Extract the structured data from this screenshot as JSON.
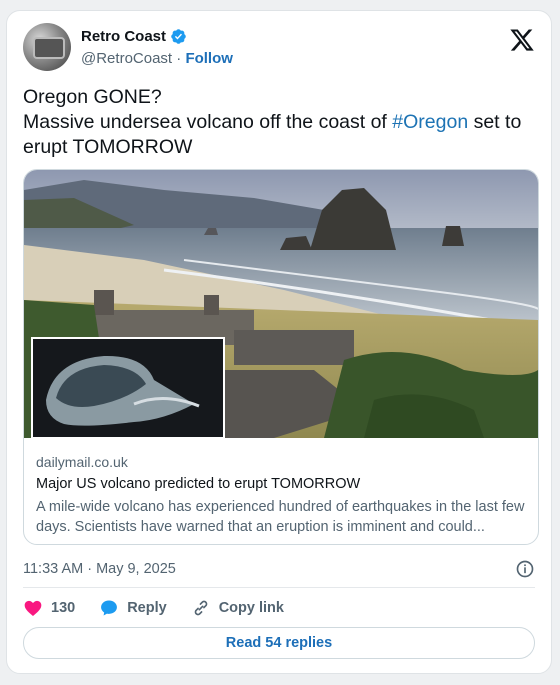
{
  "author": {
    "display_name": "Retro Coast",
    "handle": "@RetroCoast",
    "separator": "·",
    "follow_label": "Follow"
  },
  "tweet": {
    "line1": "Oregon GONE?",
    "line2_prefix": "Massive undersea volcano off the coast of ",
    "hashtag": "#Oregon",
    "line2_suffix": " set to erupt TOMORROW"
  },
  "link_card": {
    "domain": "dailymail.co.uk",
    "title": "Major US volcano predicted to erupt TOMORROW",
    "description": "A mile-wide volcano has experienced hundred of earthquakes in the last few days. Scientists have warned that an eruption is imminent and could..."
  },
  "timestamp": "11:33 AM · May 9, 2025",
  "actions": {
    "like_count": "130",
    "reply_label": "Reply",
    "copy_link_label": "Copy link"
  },
  "read_replies_label": "Read 54 replies",
  "colors": {
    "accent": "#1d6fb8",
    "like": "#f91880",
    "verified": "#1d9bf0"
  },
  "icons": [
    "verified-badge-icon",
    "x-logo-icon",
    "info-icon",
    "heart-icon",
    "reply-bubble-icon",
    "link-icon"
  ]
}
